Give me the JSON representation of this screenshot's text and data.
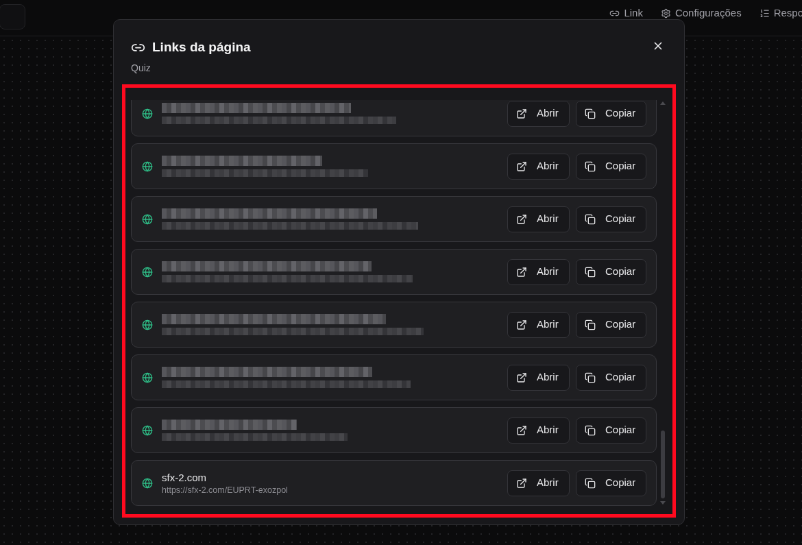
{
  "header": {
    "nav": [
      {
        "label": "Link"
      },
      {
        "label": "Configurações"
      },
      {
        "label": "Respo"
      }
    ]
  },
  "dialog": {
    "title": "Links da página",
    "subtitle": "Quiz",
    "highlighted": true,
    "links": [
      {
        "kind": "redacted",
        "open_label": "Abrir",
        "copy_label": "Copiar"
      },
      {
        "kind": "redacted",
        "open_label": "Abrir",
        "copy_label": "Copiar"
      },
      {
        "kind": "redacted",
        "open_label": "Abrir",
        "copy_label": "Copiar"
      },
      {
        "kind": "redacted",
        "open_label": "Abrir",
        "copy_label": "Copiar"
      },
      {
        "kind": "redacted",
        "open_label": "Abrir",
        "copy_label": "Copiar"
      },
      {
        "kind": "redacted",
        "open_label": "Abrir",
        "copy_label": "Copiar"
      },
      {
        "kind": "redacted",
        "open_label": "Abrir",
        "copy_label": "Copiar"
      },
      {
        "kind": "link",
        "title": "sfx-2.com",
        "url": "https://sfx-2.com/EUPRT-exozpol",
        "open_label": "Abrir",
        "copy_label": "Copiar"
      }
    ]
  }
}
